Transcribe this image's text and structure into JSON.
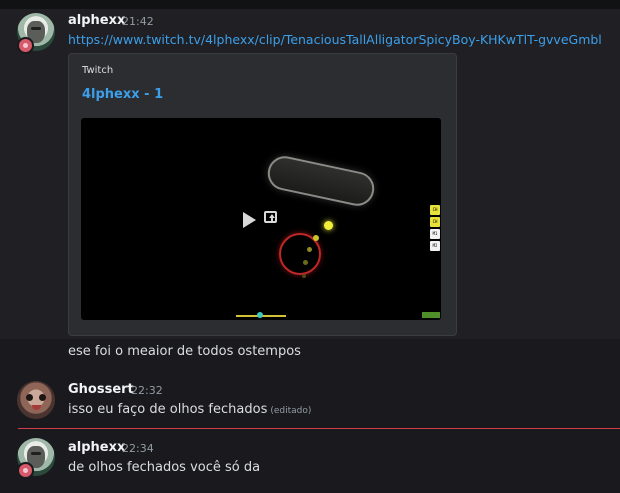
{
  "messages": [
    {
      "author": "alphexx",
      "time": "21:42",
      "link": "https://www.twitch.tv/4lphexx/clip/TenaciousTallAlligatorSpicyBoy-KHKwTlT-gvveGmbl",
      "embed": {
        "provider": "Twitch",
        "title": "4lphexx - 1",
        "player_keys": [
          "CH",
          "CH",
          "M1",
          "M2"
        ]
      }
    },
    {
      "text": "ese foi o meaior de todos ostempos"
    },
    {
      "author": "Ghossert",
      "time": "22:32",
      "text": "isso eu faço de olhos fechados",
      "edited_label": "(editado)"
    },
    {
      "author": "alphexx",
      "time": "22:34",
      "text": "de olhos fechados você só da"
    }
  ],
  "colors": {
    "background": "#1a1a1e",
    "link": "#3c9fea",
    "new_messages_divider": "#d13d4c"
  },
  "icons": [
    "avatar-alphexx",
    "avatar-ghossert",
    "play-icon",
    "popout-icon"
  ]
}
